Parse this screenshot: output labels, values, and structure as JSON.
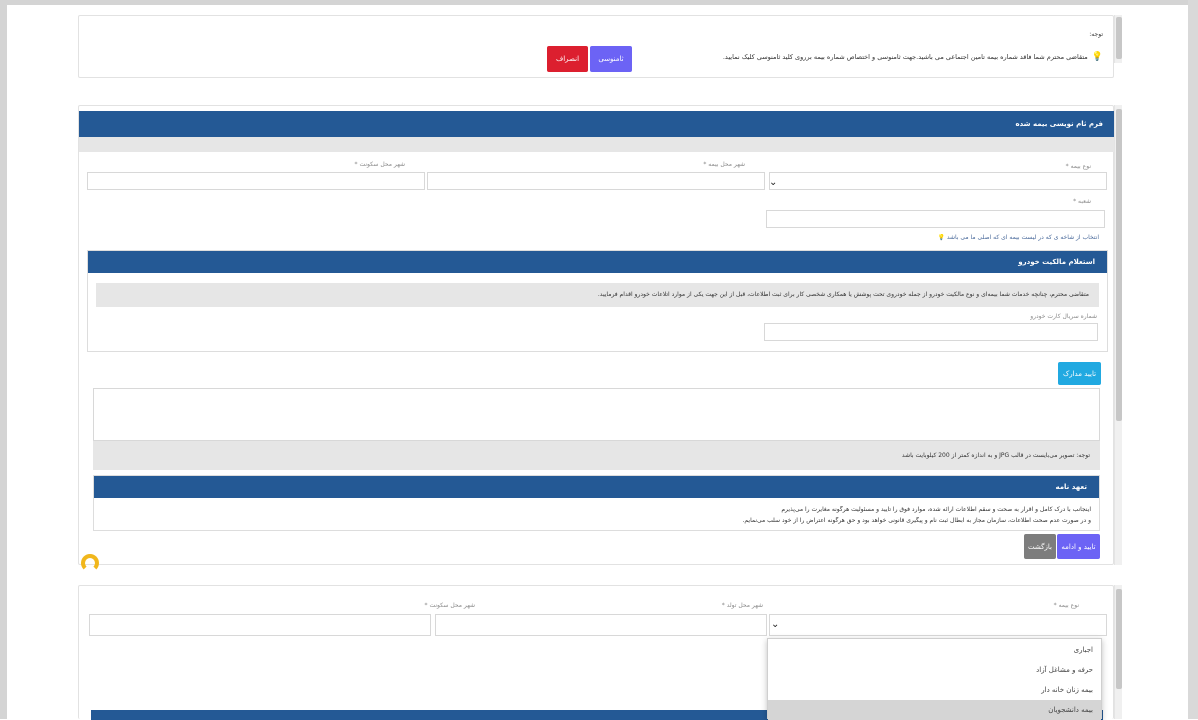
{
  "help_box": {
    "title": "توجه:",
    "message": "متقاضی محترم شما فاقد شماره بیمه تامین اجتماعی می باشید.جهت ثامنوسی و اختصاص شماره بیمه برروی کلید ثامنوسی کلیک نمایید.",
    "buttons": {
      "primary": "ثامنوسی",
      "cancel": "انصراف"
    }
  },
  "form1": {
    "header": "فرم ثام نویسی بیمه شده",
    "fields": {
      "insurance_type": "نوع بیمه *",
      "province": "شهر محل بیمه *",
      "city": "شهر محل سکونت *",
      "branch": "شعبه *"
    },
    "branch_hint": "انتخاب از شاخه ی که در لیست بیمه ای که اصلی ما می باشد",
    "inquiry": {
      "header": "استعلام مالکیت خودرو",
      "message": "متقاضی محترم، چنانچه خدمات شما بیمه‌ای و نوع مالکیت خودرو از جمله خودروی تحت پوشش یا همکاری شخصی کار برای ثبت اطلاعات، قبل از این جهت یکی از موارد اتلاعات خودرو اقدام فرمایید.",
      "field_label": "شماره سریال کارت خودرو"
    },
    "doc_button": "تایید مدارک",
    "upload_note": "توجه: تصویر می‌بایست در قالب JPG و به اندازه کمتر از 200 کیلوبایت باشد",
    "commitment": {
      "header": "تعهد نامه",
      "text_line1": "اینجانب با درک کامل و اقرار به صحت و سقم اطلاعات ارائه شده، موارد فوق را تایید و مسئولیت هرگونه مغایرت را می‌پذیرم",
      "text_line2": "و در صورت عدم صحت اطلاعات، سازمان مجاز به ابطال ثبت نام و پیگیری قانونی خواهد بود و حق هرگونه اعتراض را از خود سلب می‌نمایم."
    },
    "buttons": {
      "confirm": "تایید و ادامه",
      "back": "بازگشت"
    }
  },
  "form2": {
    "fields": {
      "insurance_type": "نوع بیمه *",
      "birth_city": "شهر محل تولد *",
      "residence_city": "شهر محل سکونت *"
    },
    "dropdown_options": [
      "اجباری",
      "حرفه و مشاغل آزاد",
      "بیمه زنان خانه دار",
      "بیمه دانشجویان"
    ],
    "selected_option": "بیمه دانشجویان"
  },
  "colors": {
    "header_bar": "#245995",
    "primary_btn": "#6c63f5",
    "cancel_btn": "#dc1f2f",
    "info_btn": "#21a9e1",
    "back_btn": "#7d7d7d"
  },
  "icons": [
    "lightbulb-icon",
    "chevron-down-icon",
    "loading-spinner-icon"
  ]
}
